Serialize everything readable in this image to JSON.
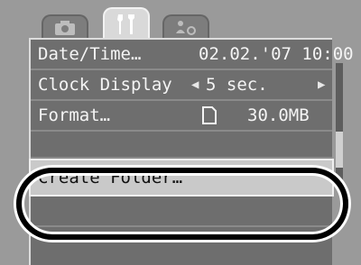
{
  "tabs": [
    {
      "icon": "camera-icon",
      "active": false
    },
    {
      "icon": "tools-icon",
      "active": true
    },
    {
      "icon": "person-settings-icon",
      "active": false
    }
  ],
  "menu": {
    "items": [
      {
        "label": "Date/Time…",
        "value": "02.02.'07 10:00"
      },
      {
        "label": "Clock Display",
        "value": "5 sec."
      },
      {
        "label": "Format…",
        "value": "30.0MB",
        "value_icon": "memory-card-icon"
      },
      {
        "label": "Create Folder…"
      }
    ]
  },
  "highlight_color": "#000000"
}
